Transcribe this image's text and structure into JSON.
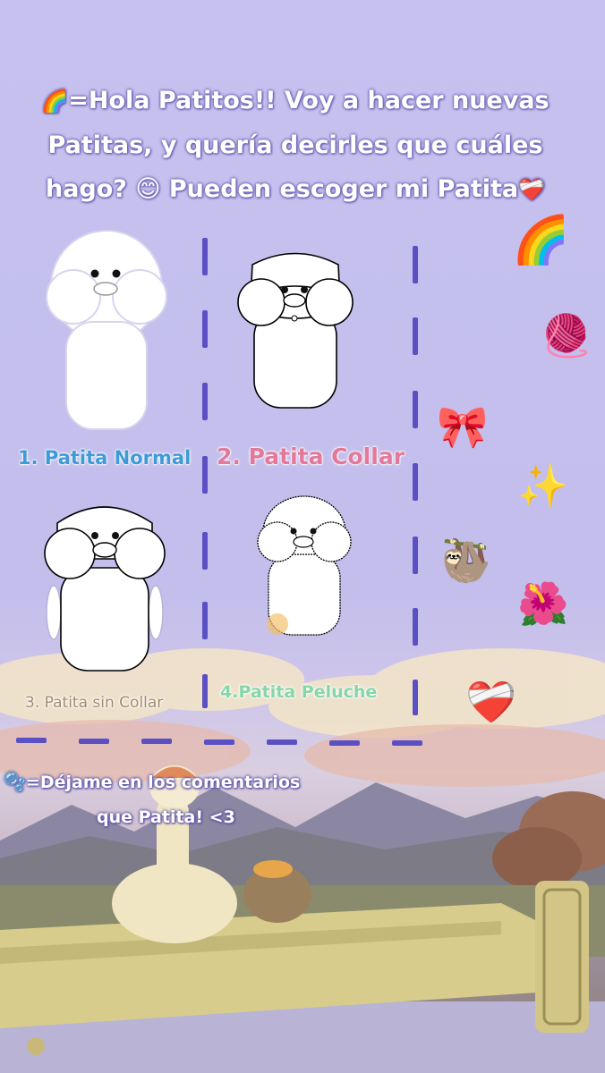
{
  "header": {
    "rainbow_emoji": "🌈",
    "line1": "=Hola Patitos!! Voy a hacer nuevas",
    "line2": "Patitas, y quería decirles que cuáles",
    "line3": "hago? 😊 Pueden escoger mi Patita",
    "heart_emoji": "❤️‍🩹"
  },
  "options": [
    {
      "label": "1. Patita Normal",
      "color": "#3f9ad8"
    },
    {
      "label": "2. Patita Collar",
      "color": "#e2799b"
    },
    {
      "label": "3. Patita sin Collar",
      "color": "#a38b6b"
    },
    {
      "label": "4.Patita Peluche",
      "color": "#86d6a8"
    }
  ],
  "side_emojis": [
    "🌈",
    "🧶",
    "🎀",
    "✨",
    "🦥",
    "🌺",
    "❤️‍🩹"
  ],
  "footer": {
    "bubbles_emoji": "🫧",
    "line1": "=Déjame en los comentarios",
    "line2": "que Patita! <3"
  },
  "colors": {
    "divider": "#5b4fc4",
    "background": "#c6c1ee"
  }
}
